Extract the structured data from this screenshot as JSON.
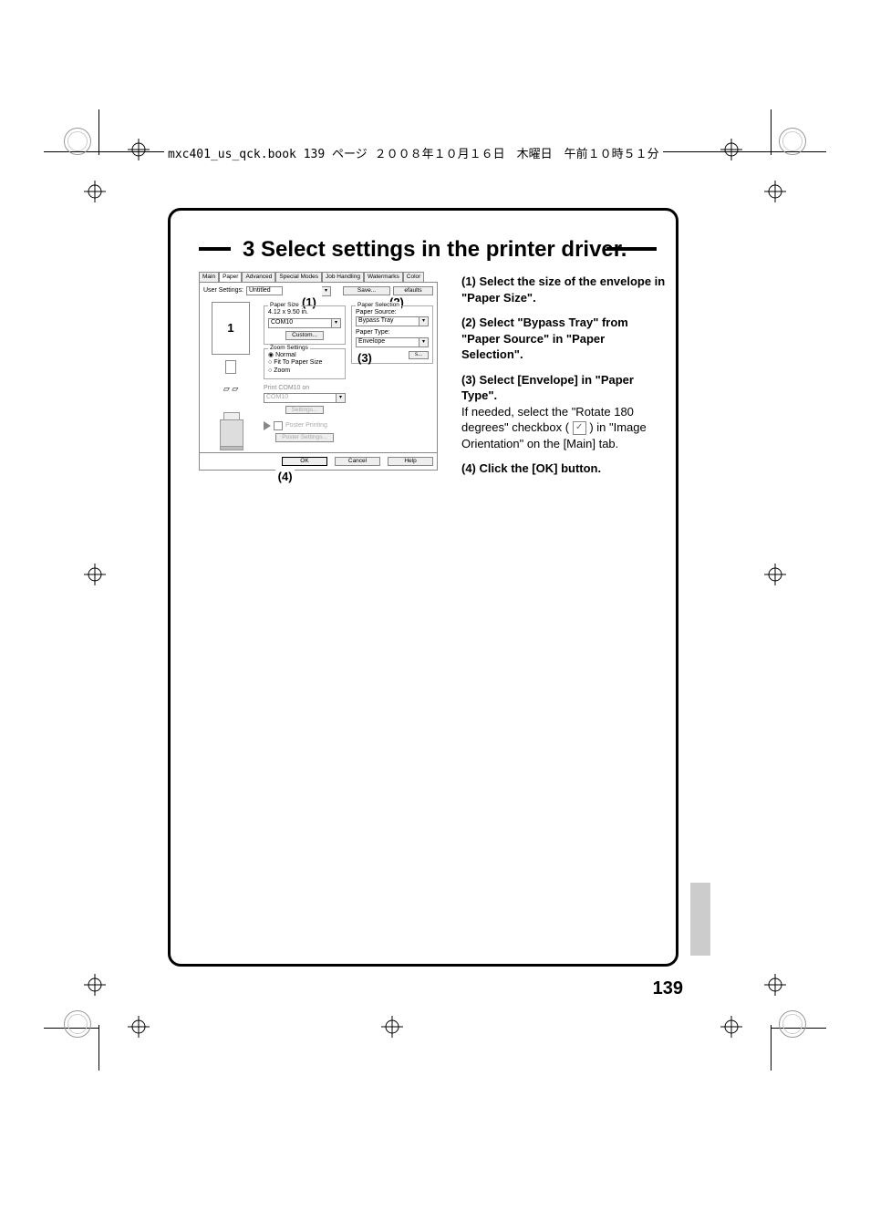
{
  "header_runner": "mxc401_us_qck.book  139 ページ  ２００８年１０月１６日　木曜日　午前１０時５１分",
  "heading": "3 Select settings in the printer driver.",
  "page_number": "139",
  "dialog": {
    "tabs": [
      "Main",
      "Paper",
      "Advanced",
      "Special Modes",
      "Job Handling",
      "Watermarks",
      "Color"
    ],
    "active_tab": "Paper",
    "user_settings_label": "User Settings:",
    "user_settings_value": "Untitled",
    "save_btn": "Save...",
    "defaults_btn": "efaults",
    "paper_size_label": "Paper Size",
    "paper_size_dim": "4.12 x 9.50 in.",
    "paper_size_value": "COM10",
    "custom_btn": "Custom...",
    "zoom_label": "Zoom Settings",
    "zoom_normal": "Normal",
    "zoom_fit": "Fit To Paper Size",
    "zoom_zoom": "Zoom",
    "print_on_label": "Print COM10 on",
    "print_on_value": "COM10",
    "settings_btn": "Settings...",
    "poster_label": "Poster Printing",
    "poster_btn": "Poster Settings...",
    "paper_selection_label": "Paper Selection",
    "paper_source_label": "Paper Source:",
    "paper_source_value": "Bypass Tray",
    "paper_type_label": "Paper Type:",
    "paper_type_value": "Envelope",
    "tray_status_btn": "Tray Status",
    "ok_btn": "OK",
    "cancel_btn": "Cancel",
    "help_btn": "Help",
    "c1": "(1)",
    "c2": "(2)",
    "c3": "(3)",
    "c4": "(4)",
    "preview_num": "1"
  },
  "instructions": {
    "i1_num": "(1)",
    "i1_bold": "Select the size of the envelope in \"Paper Size\".",
    "i2_num": "(2)",
    "i2_bold": "Select \"Bypass Tray\" from \"Paper Source\" in \"Paper Selection\".",
    "i3_num": "(3)",
    "i3_bold": "Select [Envelope] in \"Paper Type\".",
    "i3_body1": "If needed, select the \"Rotate 180 degrees\" checkbox (",
    "i3_body2": ") in \"Image Orientation\" on the [Main] tab.",
    "i4_num": "(4)",
    "i4_bold": "Click the [OK] button."
  }
}
